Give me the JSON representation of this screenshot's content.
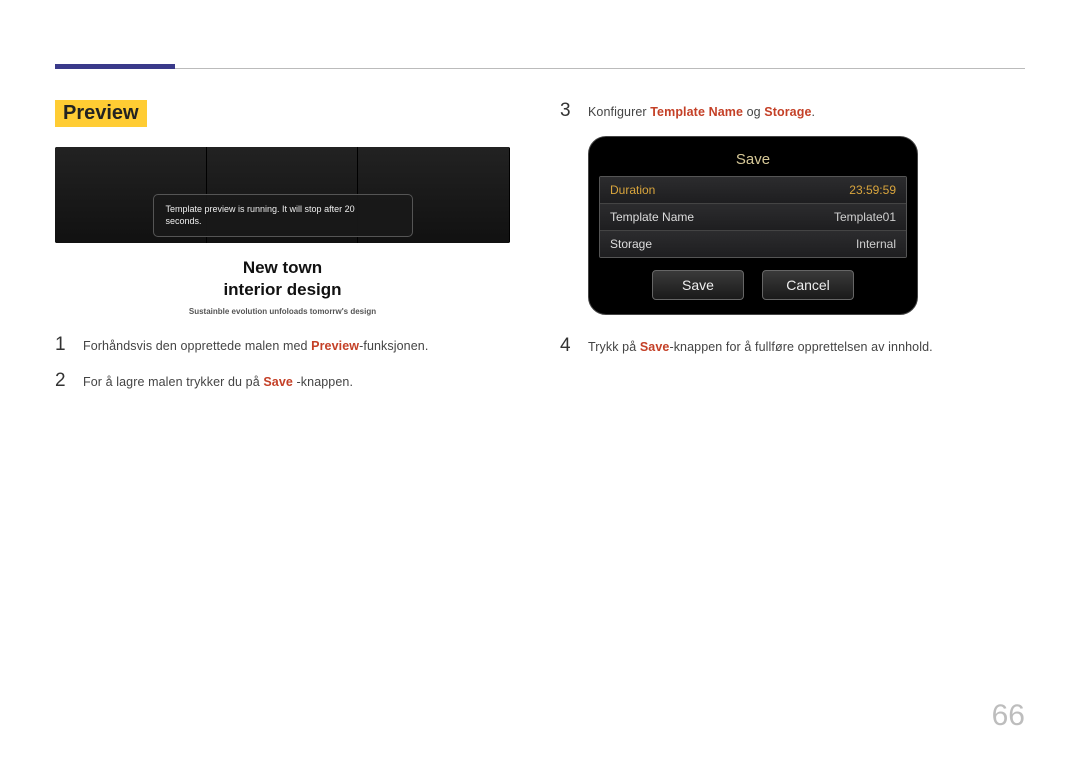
{
  "page_number": "66",
  "section_heading": "Preview",
  "preview_figure": {
    "popup_text": "Template preview is running. It will stop after 20 seconds.",
    "caption_line1": "New town",
    "caption_line2": "interior design",
    "caption_sub": "Sustainble evolution unfoloads tomorrw's design"
  },
  "left_steps": {
    "s1": {
      "num": "1",
      "pre": "Forhåndsvis den opprettede malen med ",
      "kw": "Preview",
      "post": "-funksjonen."
    },
    "s2": {
      "num": "2",
      "pre": "For å lagre malen trykker du på ",
      "kw": "Save",
      "post": " -knappen."
    }
  },
  "right_steps": {
    "s3": {
      "num": "3",
      "pre": "Konfigurer ",
      "kw1": "Template Name",
      "mid": " og ",
      "kw2": "Storage",
      "post": "."
    },
    "s4": {
      "num": "4",
      "pre": "Trykk på ",
      "kw": "Save",
      "post": "-knappen for å fullføre opprettelsen av innhold."
    }
  },
  "save_figure": {
    "title": "Save",
    "rows": {
      "r0": {
        "label": "Duration",
        "value": "23:59:59"
      },
      "r1": {
        "label": "Template Name",
        "value": "Template01"
      },
      "r2": {
        "label": "Storage",
        "value": "Internal"
      }
    },
    "buttons": {
      "save": "Save",
      "cancel": "Cancel"
    }
  }
}
